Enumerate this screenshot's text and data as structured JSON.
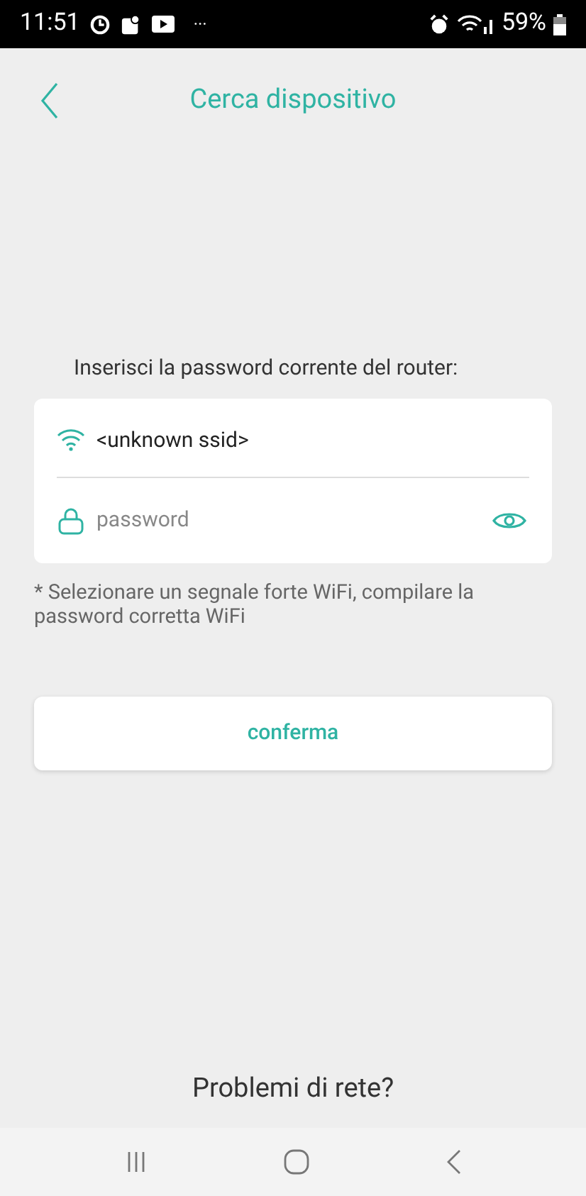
{
  "status_bar": {
    "time": "11:51",
    "overflow": "···",
    "battery": "59%"
  },
  "header": {
    "title": "Cerca dispositivo"
  },
  "form": {
    "label": "Inserisci la password corrente del router:",
    "ssid": "<unknown ssid>",
    "password": {
      "placeholder": "password",
      "visible": false
    },
    "note": "* Selezionare un segnale forte WiFi, compilare la password corretta WiFi"
  },
  "confirm_button": "conferma",
  "help_link": "Problemi di rete?"
}
